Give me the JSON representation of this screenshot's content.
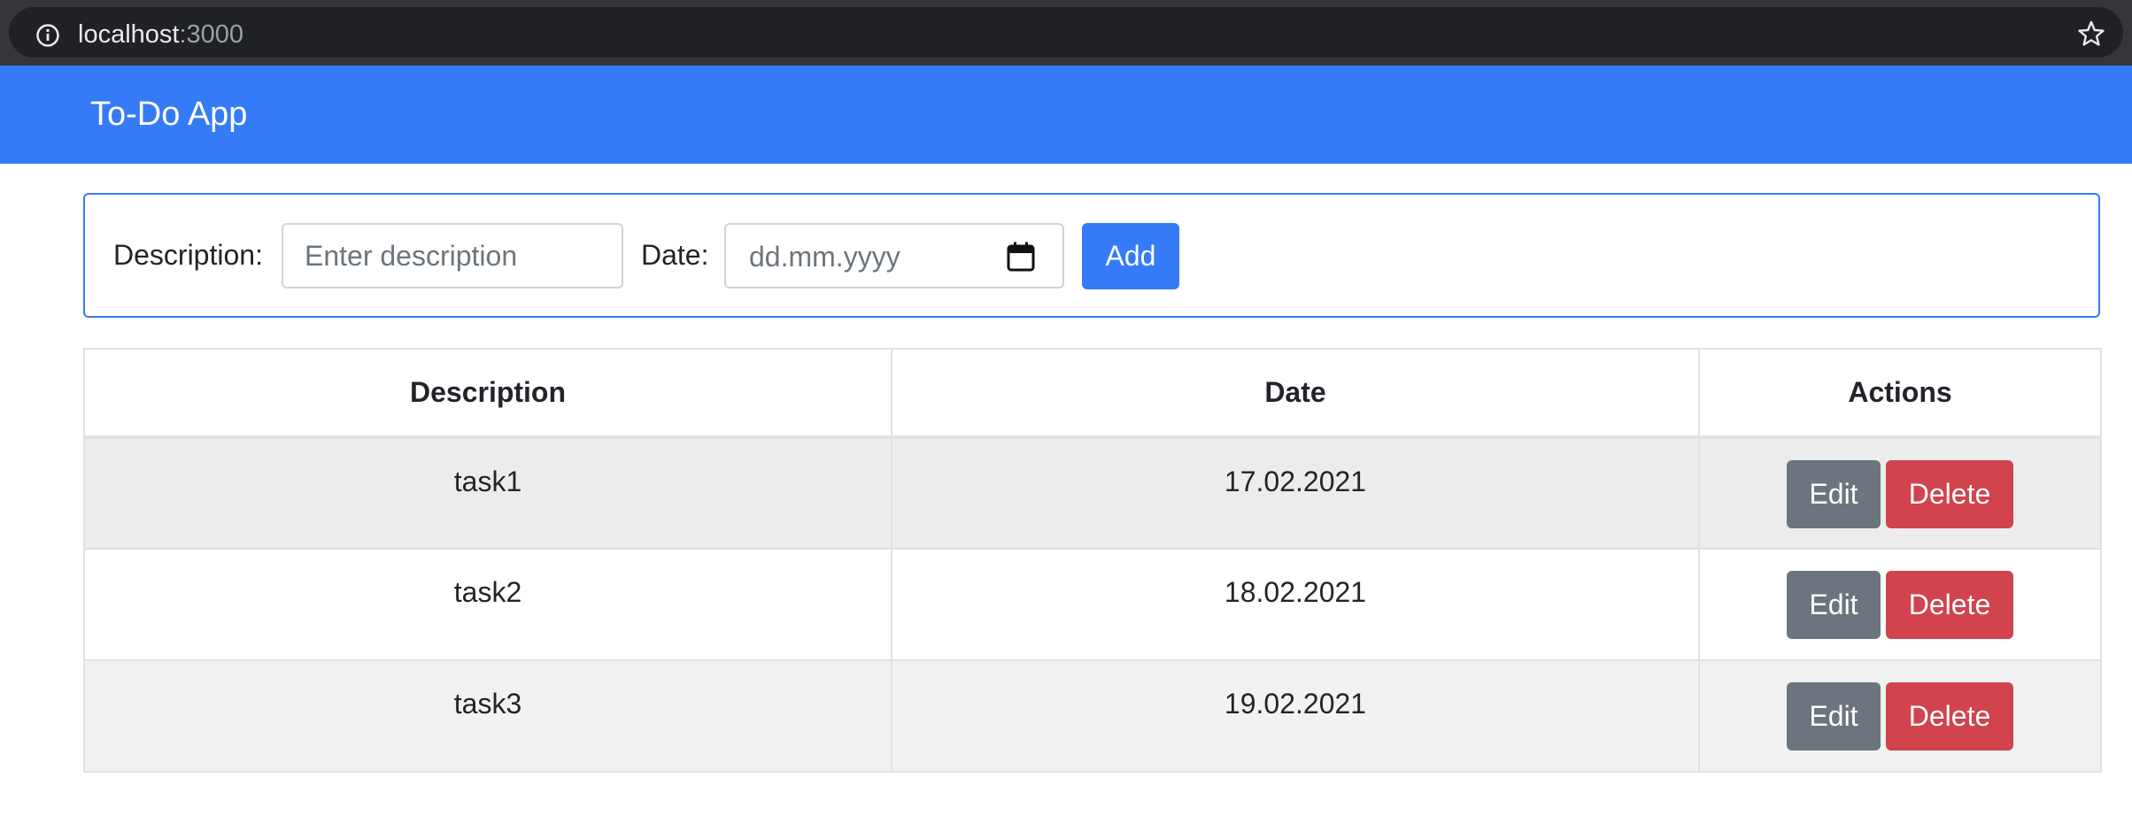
{
  "browser": {
    "url_host": "localhost",
    "url_port": ":3000",
    "icons": [
      "info-icon",
      "star-icon"
    ]
  },
  "navbar": {
    "brand": "To-Do App",
    "color": "#357bf7"
  },
  "form": {
    "description_label": "Description:",
    "description_placeholder": "Enter description",
    "date_label": "Date:",
    "date_placeholder": "dd.mm.yyyy",
    "add_label": "Add",
    "calendar_icon": "calendar-icon"
  },
  "table": {
    "headers": [
      "Description",
      "Date",
      "Actions"
    ],
    "rows": [
      {
        "description": "task1",
        "date": "17.02.2021",
        "edit": "Edit",
        "delete": "Delete"
      },
      {
        "description": "task2",
        "date": "18.02.2021",
        "edit": "Edit",
        "delete": "Delete"
      },
      {
        "description": "task3",
        "date": "19.02.2021",
        "edit": "Edit",
        "delete": "Delete"
      }
    ]
  },
  "colors": {
    "primary": "#357bf7",
    "secondary": "#6c757d",
    "danger": "#d1434d"
  }
}
